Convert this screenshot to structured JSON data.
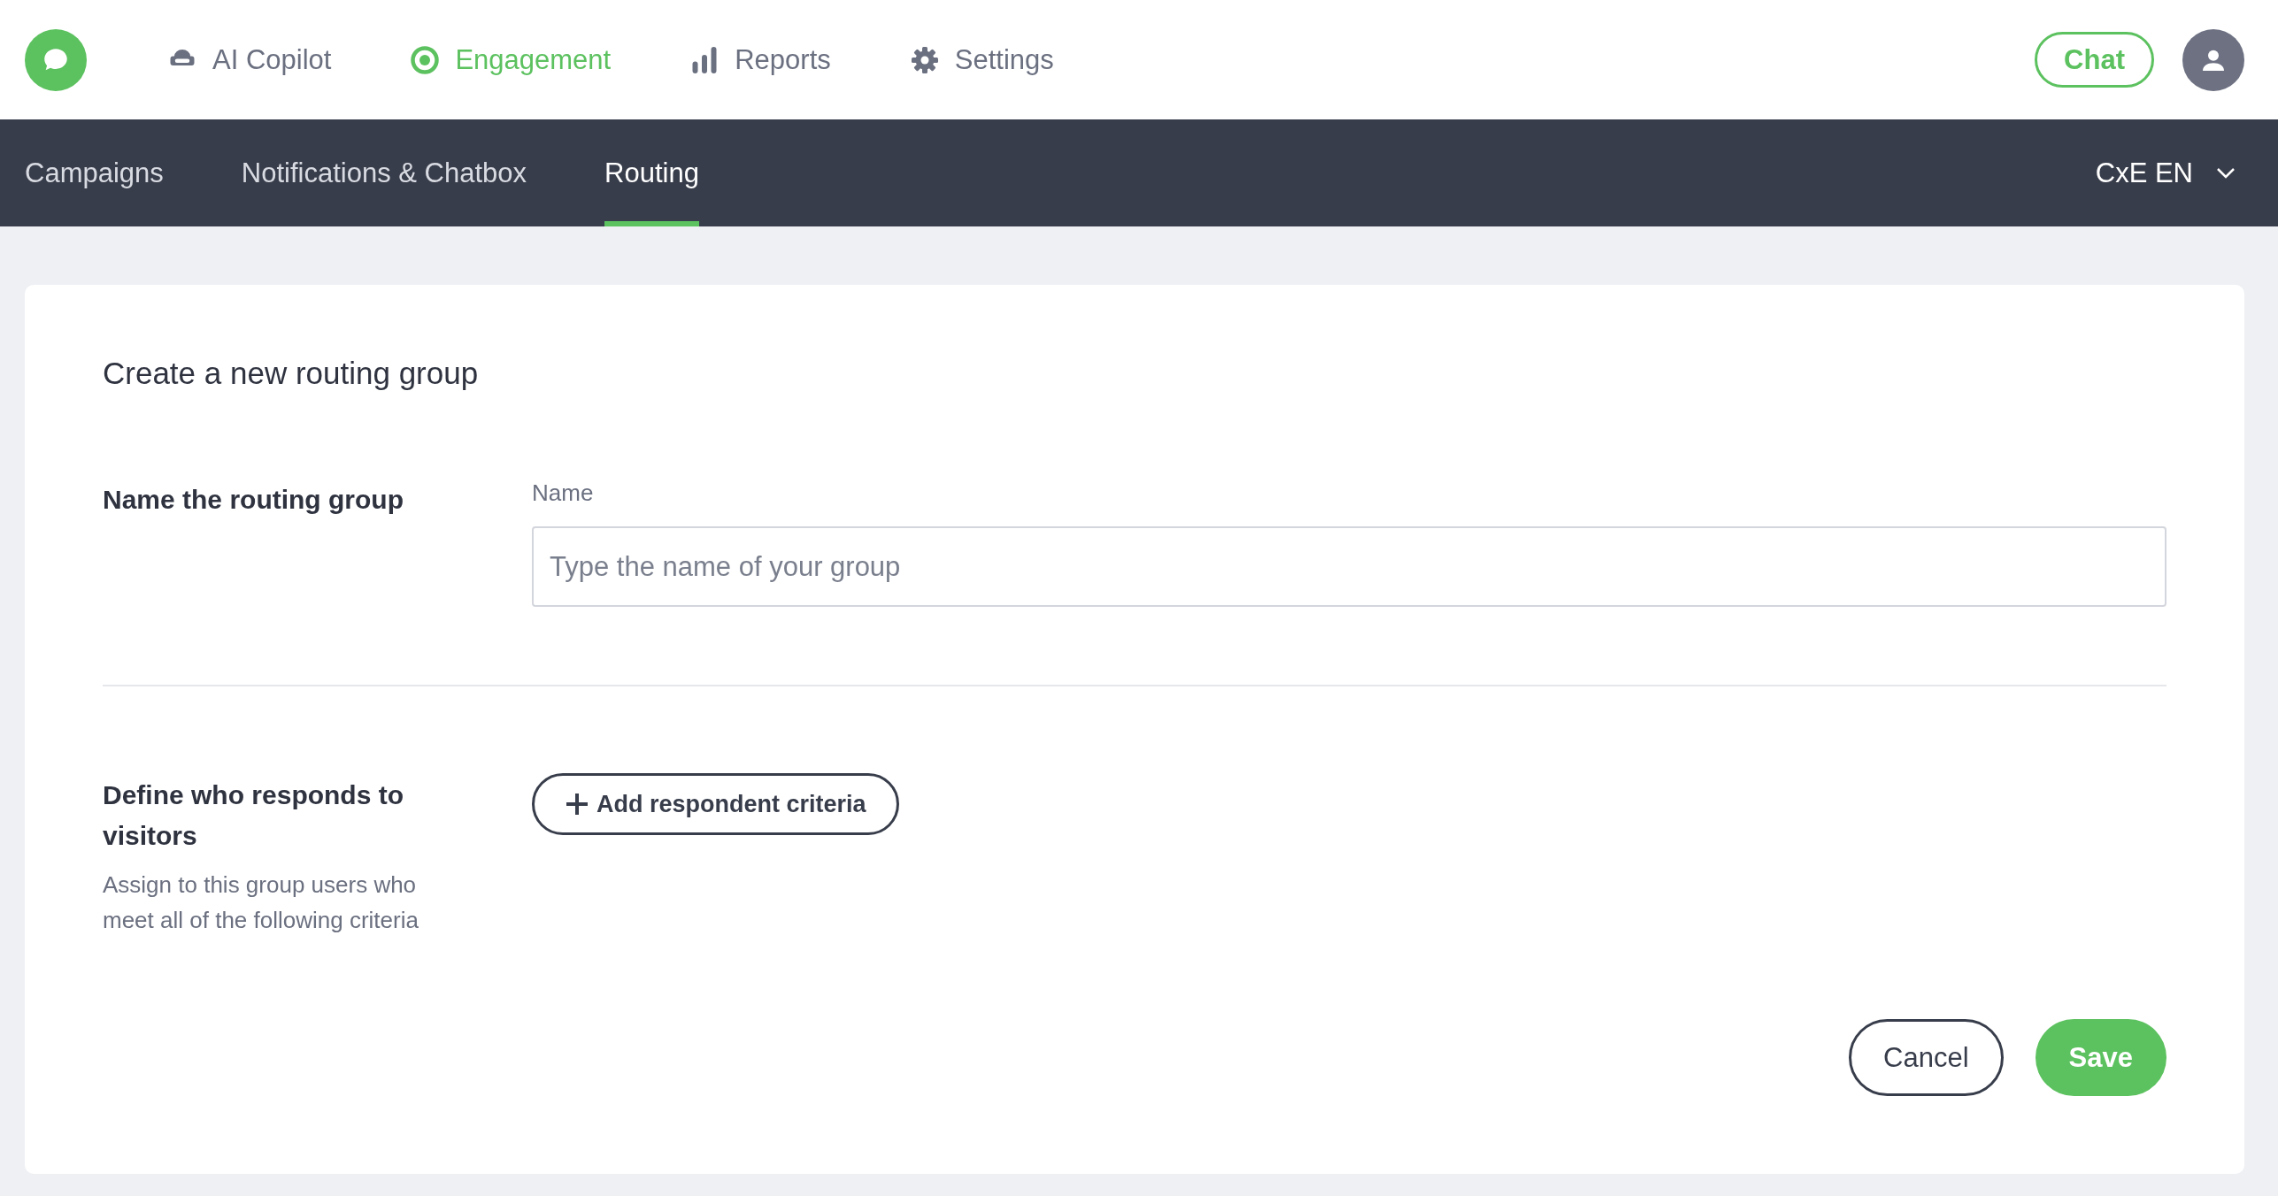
{
  "top_nav": {
    "items": [
      {
        "label": "AI Copilot",
        "kind": "copilot",
        "selected": false
      },
      {
        "label": "Engagement",
        "kind": "engagement",
        "selected": true
      },
      {
        "label": "Reports",
        "kind": "reports",
        "selected": false
      },
      {
        "label": "Settings",
        "kind": "settings",
        "selected": false
      }
    ],
    "chat_button": "Chat"
  },
  "sub_nav": {
    "tabs": [
      {
        "label": "Campaigns",
        "selected": false
      },
      {
        "label": "Notifications & Chatbox",
        "selected": false
      },
      {
        "label": "Routing",
        "selected": true
      }
    ],
    "workspace": "CxE EN"
  },
  "form": {
    "title": "Create a new routing group",
    "name_section": {
      "heading": "Name the routing group",
      "field_label": "Name",
      "placeholder": "Type the name of your group"
    },
    "respondents_section": {
      "heading": "Define who responds to visitors",
      "description": "Assign to this group users who meet all of the following criteria",
      "add_button": "Add respondent criteria"
    },
    "buttons": {
      "cancel": "Cancel",
      "save": "Save"
    }
  }
}
